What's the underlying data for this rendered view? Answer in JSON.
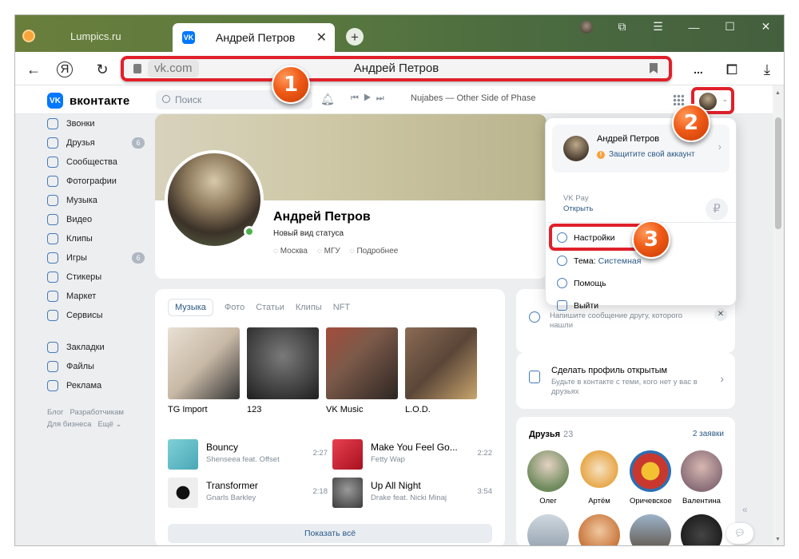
{
  "browser": {
    "tabs": [
      {
        "label": "Lumpics.ru"
      },
      {
        "label": "Андрей Петров"
      }
    ],
    "address": {
      "domain": "vk.com",
      "title": "Андрей Петров"
    },
    "menu_label": "..."
  },
  "vk": {
    "logo": "вконтакте",
    "search_placeholder": "Поиск",
    "now_playing": "Nujabes — Other Side of Phase",
    "nav": [
      {
        "label": "Звонки",
        "icon": "phone-icon"
      },
      {
        "label": "Друзья",
        "icon": "friends-icon",
        "badge": "6"
      },
      {
        "label": "Сообщества",
        "icon": "communities-icon"
      },
      {
        "label": "Фотографии",
        "icon": "photos-icon"
      },
      {
        "label": "Музыка",
        "icon": "music-icon"
      },
      {
        "label": "Видео",
        "icon": "video-icon"
      },
      {
        "label": "Клипы",
        "icon": "clips-icon"
      },
      {
        "label": "Игры",
        "icon": "games-icon",
        "badge": "6"
      },
      {
        "label": "Стикеры",
        "icon": "stickers-icon"
      },
      {
        "label": "Маркет",
        "icon": "market-icon"
      },
      {
        "label": "Сервисы",
        "icon": "services-icon"
      },
      {
        "label": "Закладки",
        "icon": "bookmarks-icon"
      },
      {
        "label": "Файлы",
        "icon": "files-icon"
      },
      {
        "label": "Реклама",
        "icon": "ads-icon"
      }
    ],
    "footer": {
      "blog": "Блог",
      "dev": "Разработчикам",
      "business": "Для бизнеса",
      "more": "Ещё ⌄"
    },
    "profile": {
      "name": "Андрей Петров",
      "status": "Новый вид статуса",
      "city": "Москва",
      "university": "МГУ",
      "more": "Подробнее"
    },
    "media_tabs": [
      "Музыка",
      "Фото",
      "Статьи",
      "Клипы",
      "NFT"
    ],
    "albums": [
      {
        "title": "TG Import",
        "color": "#c8b9a6"
      },
      {
        "title": "123",
        "color": "#3b3b3b"
      },
      {
        "title": "VK Music",
        "color": "#7c5a4a"
      },
      {
        "title": "L.O.D.",
        "color": "#5a4638"
      }
    ],
    "tracks": [
      {
        "title": "Bouncy",
        "artist": "Shenseea feat. Offset",
        "duration": "2:27",
        "color": "#4aa7b5"
      },
      {
        "title": "Make You Feel Go...",
        "artist": "Fetty Wap",
        "duration": "2:22",
        "color": "#d7263d"
      },
      {
        "title": "Transformer",
        "artist": "Gnarls Barkley",
        "duration": "2:18",
        "color": "#222222"
      },
      {
        "title": "Up All Night",
        "artist": "Drake feat. Nicki Minaj",
        "duration": "3:54",
        "color": "#6b6b6b"
      }
    ],
    "show_all": "Показать всё",
    "message_hint": "Напишите сообщение другу, которого нашли",
    "open_profile": {
      "title": "Сделать профиль открытым",
      "subtitle": "Будьте в контакте с теми, кого нет у вас в друзьях"
    },
    "friends": {
      "title": "Друзья",
      "count": "23",
      "requests": "2 заявки",
      "list": [
        {
          "name": "Олег",
          "color": "#6f8a5d"
        },
        {
          "name": "Артём",
          "color": "#e7a84b"
        },
        {
          "name": "Оричевское",
          "color": "#c9382f"
        },
        {
          "name": "Валентина",
          "color": "#8a6f7a"
        }
      ],
      "more_colors": [
        "#8c9aa6",
        "#c8743a",
        "#5a4a3a",
        "#2b2b2b"
      ]
    }
  },
  "dropdown": {
    "name": "Андрей Петров",
    "warning": "Защитите свой аккаунт",
    "vkpay": "VK Pay",
    "open": "Открыть",
    "rub": "₽",
    "items": {
      "settings": "Настройки",
      "theme": "Тема:",
      "theme_value": "Системная",
      "help": "Помощь",
      "logout": "Выйти"
    }
  },
  "steps": [
    "1",
    "2",
    "3"
  ]
}
